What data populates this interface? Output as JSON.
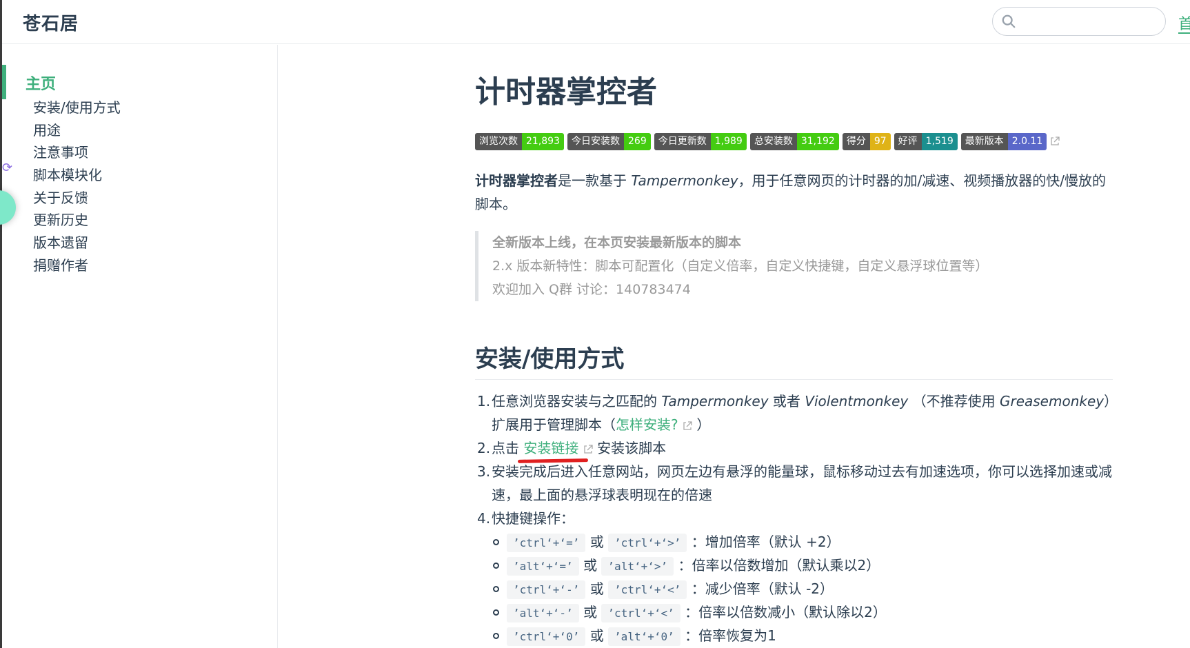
{
  "navbar": {
    "site_name": "苍石居",
    "search_placeholder": "",
    "nav_link": "首"
  },
  "sidebar": {
    "active_item": "主页",
    "items": [
      "安装/使用方式",
      "用途",
      "注意事项",
      "脚本模块化",
      "关于反馈",
      "更新历史",
      "版本遗留",
      "捐赠作者"
    ]
  },
  "main": {
    "title": "计时器掌控者",
    "badges": [
      {
        "label": "浏览次数",
        "value": "21,893",
        "color": "#4c1"
      },
      {
        "label": "今日安装数",
        "value": "269",
        "color": "#4c1"
      },
      {
        "label": "今日更新数",
        "value": "1,989",
        "color": "#4c1"
      },
      {
        "label": "总安装数",
        "value": "31,192",
        "color": "#4c1"
      },
      {
        "label": "得分",
        "value": "97",
        "color": "#dfb317"
      },
      {
        "label": "好评",
        "value": "1,519",
        "color": "#1b8f8f"
      },
      {
        "label": "最新版本",
        "value": "2.0.11",
        "color": "#5a67c9"
      }
    ],
    "intro": {
      "name": "计时器掌控者",
      "text_1": "是一款基于 ",
      "tampermonkey": "Tampermonkey",
      "text_2": "，用于任意网页的计时器的加/减速、视频播放器的快/慢放的脚本。"
    },
    "notice": {
      "line1": "全新版本上线，在本页安装最新版本的脚本",
      "line2": "2.x 版本新特性：脚本可配置化（自定义倍率，自定义快捷键，自定义悬浮球位置等）",
      "line3": "欢迎加入 Q群 讨论：140783474"
    },
    "section_install": {
      "title": "安装/使用方式",
      "step1": {
        "num": "1.",
        "text_a": "任意浏览器安装与之匹配的 ",
        "tampermonkey": "Tampermonkey",
        "text_b": " 或者 ",
        "violentmonkey": "Violentmonkey",
        "text_c": " （不推荐使用 ",
        "greasemonkey": "Greasemonkey",
        "text_d": "）扩展用于管理脚本（",
        "link": "怎样安装?",
        "text_e": " ）"
      },
      "step2": {
        "num": "2.",
        "text_a": "点击 ",
        "link": "安装链接",
        "text_b": " 安装该脚本"
      },
      "step3": {
        "num": "3.",
        "text": "安装完成后进入任意网站，网页左边有悬浮的能量球，鼠标移动过去有加速选项，你可以选择加速或减速，最上面的悬浮球表明现在的倍速"
      },
      "step4": {
        "num": "4.",
        "text": "快捷键操作："
      },
      "shortcuts": [
        {
          "key1": "’ctrl‘+‘=’",
          "or": "或",
          "key2": "’ctrl‘+‘>’",
          "desc": "：增加倍率（默认 +2）"
        },
        {
          "key1": "’alt‘+‘=’",
          "or": "或",
          "key2": "’alt‘+‘>’",
          "desc": "：倍率以倍数增加（默认乘以2）"
        },
        {
          "key1": "’ctrl‘+‘-’",
          "or": "或",
          "key2": "’ctrl‘+‘<’",
          "desc": "：减少倍率（默认 -2）"
        },
        {
          "key1": "’alt‘+‘-’",
          "or": "或",
          "key2": "’ctrl‘+‘<’",
          "desc": "：倍率以倍数减小（默认除以2）"
        },
        {
          "key1": "’ctrl‘+‘0’",
          "or": "或",
          "key2": "’alt‘+‘0’",
          "desc": "：倍率恢复为1"
        }
      ]
    }
  }
}
